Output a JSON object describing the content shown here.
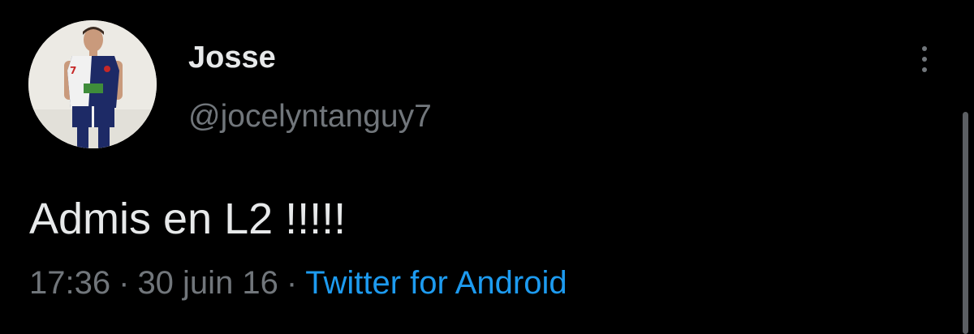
{
  "tweet": {
    "display_name": "Josse",
    "handle": "@jocelyntanguy7",
    "text": "Admis en L2 !!!!!",
    "time": "17:36",
    "separator": "·",
    "date": "30 juin 16",
    "source": "Twitter for Android"
  },
  "icons": {
    "more": "more-vertical-icon"
  },
  "colors": {
    "background": "#000000",
    "primary_text": "#e7e9ea",
    "secondary_text": "#71767b",
    "link": "#1d9bf0"
  }
}
